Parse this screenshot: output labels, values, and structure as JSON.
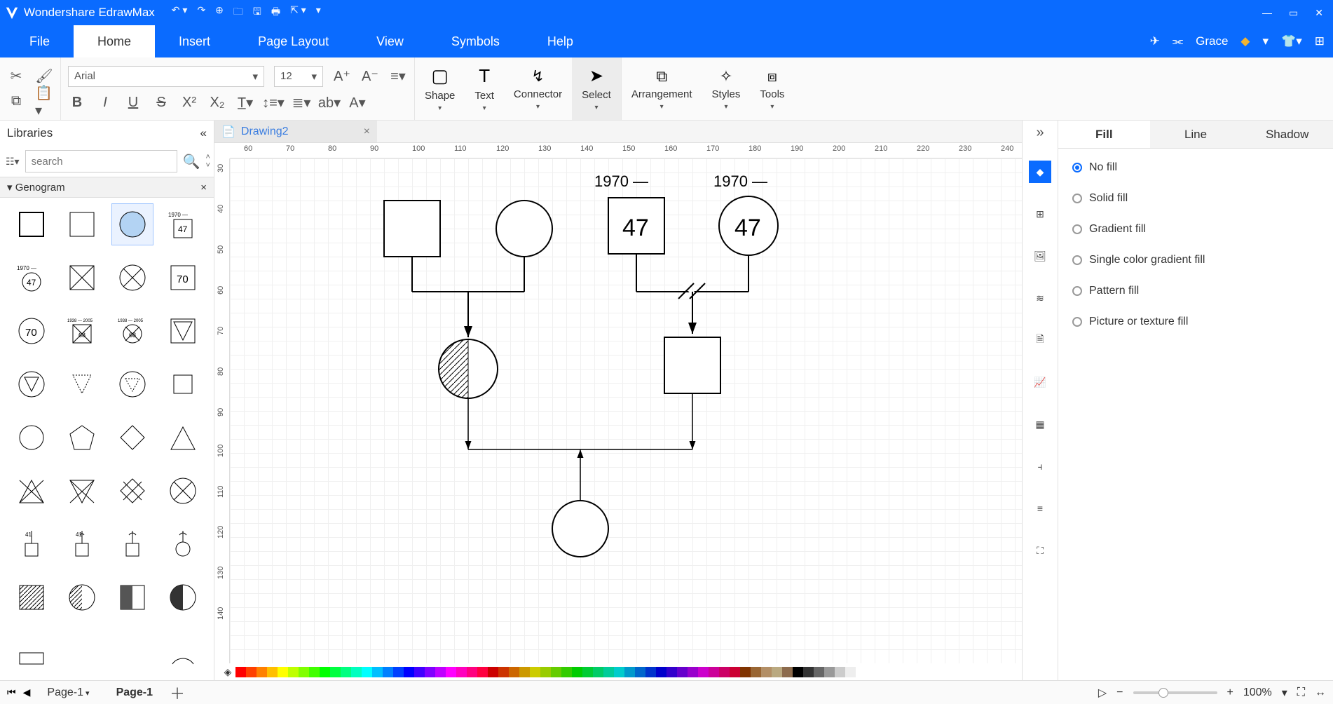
{
  "app": {
    "title": "Wondershare EdrawMax"
  },
  "menu": {
    "items": [
      "File",
      "Home",
      "Insert",
      "Page Layout",
      "View",
      "Symbols",
      "Help"
    ],
    "active": 1,
    "user": "Grace"
  },
  "ribbon": {
    "font": "Arial",
    "size": "12",
    "tools": [
      {
        "label": "Shape"
      },
      {
        "label": "Text"
      },
      {
        "label": "Connector"
      },
      {
        "label": "Select",
        "selected": true
      },
      {
        "label": "Arrangement"
      },
      {
        "label": "Styles"
      },
      {
        "label": "Tools"
      }
    ]
  },
  "libraries": {
    "title": "Libraries",
    "search_placeholder": "search",
    "category": "Genogram"
  },
  "document": {
    "tab_label": "Drawing2"
  },
  "ruler_h": [
    60,
    70,
    80,
    90,
    100,
    110,
    120,
    130,
    140,
    150,
    160,
    170,
    180,
    190,
    200,
    210,
    220,
    230,
    240
  ],
  "ruler_v": [
    30,
    40,
    50,
    60,
    70,
    80,
    90,
    100,
    110,
    120,
    130,
    140
  ],
  "canvas": {
    "labels": {
      "year_left": "1970 —",
      "year_right": "1970 —",
      "age_left": "47",
      "age_right": "47"
    }
  },
  "proptabs": {
    "items": [
      "Fill",
      "Line",
      "Shadow"
    ],
    "active": 0
  },
  "fill_options": [
    "No fill",
    "Solid fill",
    "Gradient fill",
    "Single color gradient fill",
    "Pattern fill",
    "Picture or texture fill"
  ],
  "fill_selected": 0,
  "status": {
    "page_menu": "Page-1",
    "page_active": "Page-1",
    "zoom": "100%"
  },
  "palette": [
    "#ff0000",
    "#ff4000",
    "#ff8000",
    "#ffbf00",
    "#ffff00",
    "#bfff00",
    "#80ff00",
    "#40ff00",
    "#00ff00",
    "#00ff40",
    "#00ff80",
    "#00ffbf",
    "#00ffff",
    "#00bfff",
    "#0080ff",
    "#0040ff",
    "#0000ff",
    "#4000ff",
    "#8000ff",
    "#bf00ff",
    "#ff00ff",
    "#ff00bf",
    "#ff0080",
    "#ff0040",
    "#cc0000",
    "#cc3300",
    "#cc6600",
    "#cc9900",
    "#cccc00",
    "#99cc00",
    "#66cc00",
    "#33cc00",
    "#00cc00",
    "#00cc33",
    "#00cc66",
    "#00cc99",
    "#00cccc",
    "#0099cc",
    "#0066cc",
    "#0033cc",
    "#0000cc",
    "#3300cc",
    "#6600cc",
    "#9900cc",
    "#cc00cc",
    "#cc0099",
    "#cc0066",
    "#cc0033",
    "#803300",
    "#996633",
    "#b38f66",
    "#baa980",
    "#8c6b4d",
    "#000000",
    "#333333",
    "#666666",
    "#999999",
    "#cccccc",
    "#eeeeee",
    "#ffffff"
  ]
}
